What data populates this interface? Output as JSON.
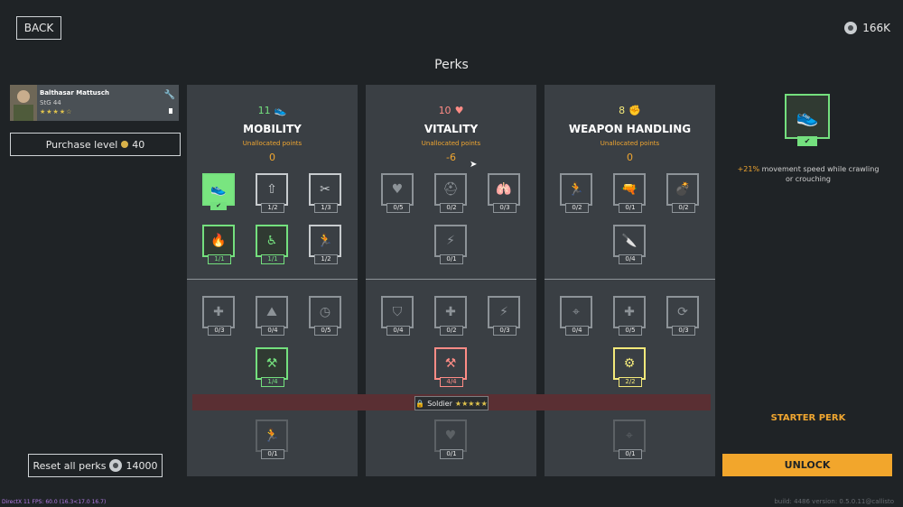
{
  "header": {
    "back_label": "BACK",
    "currency_value": "166K",
    "page_title": "Perks"
  },
  "character": {
    "name": "Balthasar Mattusch",
    "weapon": "StG 44",
    "stars": "★★★★☆",
    "purchase_label": "Purchase level",
    "purchase_cost": "40"
  },
  "reset": {
    "label": "Reset all perks",
    "cost": "14000"
  },
  "panels": [
    {
      "count": "11",
      "name": "MOBILITY",
      "unallocated_label": "Unallocated points",
      "points": "0",
      "count_color": "#74e07e",
      "tiles": [
        {
          "state": "green-fill",
          "glyph": "👟",
          "badge": "",
          "checked": true
        },
        {
          "state": "normal",
          "glyph": "⇧",
          "badge": "1/2"
        },
        {
          "state": "normal",
          "glyph": "✂",
          "badge": "1/3"
        },
        {
          "state": "green",
          "glyph": "🔥",
          "badge": "1/1"
        },
        {
          "state": "green",
          "glyph": "♿",
          "badge": "1/1"
        },
        {
          "state": "normal",
          "glyph": "🏃",
          "badge": "1/2"
        },
        {
          "state": "dim",
          "glyph": "✚",
          "badge": "0/3"
        },
        {
          "state": "dim",
          "glyph": "⛰",
          "badge": "0/4"
        },
        {
          "state": "dim",
          "glyph": "◷",
          "badge": "0/5"
        },
        {
          "state": "green",
          "glyph": "⚒",
          "badge": "1/4"
        },
        {
          "state": "faded",
          "glyph": "🏃",
          "badge": "0/1"
        }
      ]
    },
    {
      "count": "10",
      "name": "VITALITY",
      "unallocated_label": "Unallocated points",
      "points": "-6",
      "count_color": "#ff8c86",
      "tiles": [
        {
          "state": "dim",
          "glyph": "♥",
          "badge": "0/5"
        },
        {
          "state": "dim",
          "glyph": "⛑",
          "badge": "0/2"
        },
        {
          "state": "dim",
          "glyph": "🫁",
          "badge": "0/3"
        },
        {
          "state": "dim",
          "glyph": "⚡",
          "badge": "0/1"
        },
        {
          "state": "dim",
          "glyph": "⛉",
          "badge": "0/4"
        },
        {
          "state": "dim",
          "glyph": "✚",
          "badge": "0/2"
        },
        {
          "state": "dim",
          "glyph": "⚡",
          "badge": "0/3"
        },
        {
          "state": "red",
          "glyph": "⚒",
          "badge": "4/4"
        },
        {
          "state": "faded",
          "glyph": "♥",
          "badge": "0/1"
        }
      ]
    },
    {
      "count": "8",
      "name": "WEAPON HANDLING",
      "unallocated_label": "Unallocated points",
      "points": "0",
      "count_color": "#f3e97a",
      "tiles": [
        {
          "state": "dim",
          "glyph": "🏃",
          "badge": "0/2"
        },
        {
          "state": "dim",
          "glyph": "🔫",
          "badge": "0/1"
        },
        {
          "state": "dim",
          "glyph": "💣",
          "badge": "0/2"
        },
        {
          "state": "dim",
          "glyph": "🔪",
          "badge": "0/4"
        },
        {
          "state": "dim",
          "glyph": "⌖",
          "badge": "0/4"
        },
        {
          "state": "dim",
          "glyph": "✚",
          "badge": "0/5"
        },
        {
          "state": "dim",
          "glyph": "⟳",
          "badge": "0/3"
        },
        {
          "state": "yellow",
          "glyph": "⚙",
          "badge": "2/2"
        },
        {
          "state": "faded",
          "glyph": "⌖",
          "badge": "0/1"
        }
      ]
    }
  ],
  "lock": {
    "label": "Soldier",
    "stars": "★★★★★"
  },
  "selected_perk": {
    "desc_highlight": "+21%",
    "desc_text": " movement speed while crawling or crouching",
    "starter_label": "STARTER PERK",
    "unlock_label": "UNLOCK"
  },
  "footer": {
    "left": "DirectX 11 FPS: 60.0 (16.3<17.0 16.7)",
    "right": "build: 4486 version: 0.5.0.11@callisto"
  },
  "colors": {
    "accent": "#f2a62c",
    "unlocked": "#74e07e",
    "background": "#1f2326",
    "panel": "#3a3f44"
  }
}
